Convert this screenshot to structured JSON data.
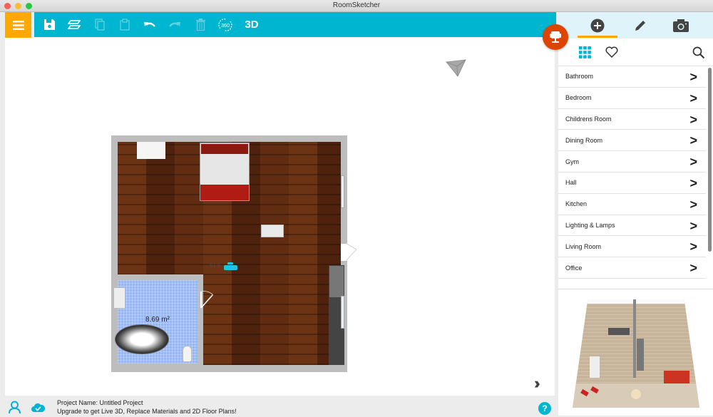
{
  "window": {
    "title": "RoomSketcher"
  },
  "toolbar": {
    "menu_icon": "hamburger-menu-icon",
    "items": [
      {
        "name": "save",
        "icon": "floppy-disk-icon",
        "enabled": true
      },
      {
        "name": "floors",
        "icon": "layers-icon",
        "enabled": true
      },
      {
        "name": "copy",
        "icon": "copy-icon",
        "enabled": false
      },
      {
        "name": "paste",
        "icon": "clipboard-icon",
        "enabled": false
      },
      {
        "name": "undo",
        "icon": "undo-icon",
        "enabled": true
      },
      {
        "name": "redo",
        "icon": "redo-icon",
        "enabled": false
      },
      {
        "name": "delete",
        "icon": "trash-icon",
        "enabled": false
      },
      {
        "name": "view-360",
        "icon": "rotate-360-icon",
        "label": "360",
        "enabled": true
      },
      {
        "name": "view-3d",
        "label": "3D",
        "enabled": true
      }
    ]
  },
  "right_panel": {
    "tabs": [
      {
        "name": "add",
        "icon": "plus-circle-icon",
        "active": true
      },
      {
        "name": "edit",
        "icon": "pencil-icon",
        "active": false
      },
      {
        "name": "snapshot",
        "icon": "camera-icon",
        "active": false
      }
    ],
    "subtabs": [
      {
        "name": "catalog",
        "icon": "grid-icon",
        "active": true
      },
      {
        "name": "favorites",
        "icon": "heart-icon",
        "active": false
      }
    ],
    "search_icon": "search-icon",
    "categories": [
      {
        "label": "Bathroom"
      },
      {
        "label": "Bedroom"
      },
      {
        "label": "Childrens Room"
      },
      {
        "label": "Dining Room"
      },
      {
        "label": "Gym"
      },
      {
        "label": "Hall"
      },
      {
        "label": "Kitchen"
      },
      {
        "label": "Lighting & Lamps"
      },
      {
        "label": "Living Room"
      },
      {
        "label": "Office"
      }
    ]
  },
  "floor_plan": {
    "bathroom_area_label": "8.69 m²",
    "selected_label": "51.5"
  },
  "status": {
    "project_name": "Project Name: Untitled Project",
    "upgrade_message": "Upgrade to get Live 3D, Replace Materials and 2D Floor Plans!",
    "help_label": "?"
  },
  "colors": {
    "toolbar": "#00b5cf",
    "menu_button": "#ffa800",
    "fab": "#dd4400",
    "active_tab_underline": "#ffa800"
  }
}
